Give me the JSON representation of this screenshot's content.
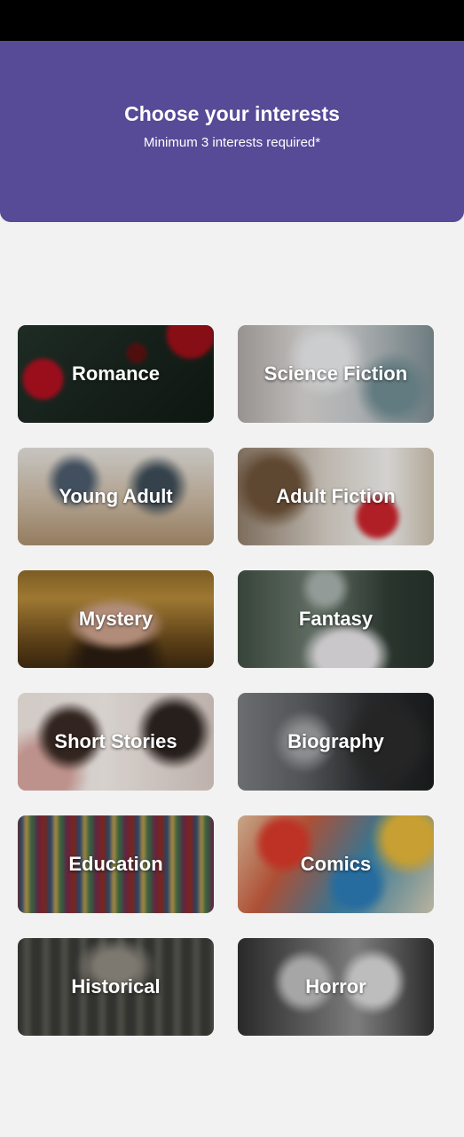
{
  "header": {
    "title": "Choose your interests",
    "subtitle": "Minimum 3 interests required*"
  },
  "interests": [
    {
      "label": "Romance",
      "background": "radial-gradient(circle at 15% 55%, #b01020 0 10%, transparent 12%), radial-gradient(circle at 86% 12%, #9b1018 0 11%, transparent 13%), radial-gradient(circle at 60% 30%, #5b1210 0 6%, transparent 8%), linear-gradient(135deg, #22332a 0%, #1a261f 45%, #101a14 100%)"
    },
    {
      "label": "Science Fiction",
      "background": "radial-gradient(circle at 45% 35%, #e9eaec 0 16%, transparent 30%), radial-gradient(circle at 78% 65%, #6f8c92 0 12%, transparent 22%), linear-gradient(90deg, #a9a3a0 0%, #d9d6d4 35%, #c4c8ca 60%, #77898e 100%)"
    },
    {
      "label": "Young Adult",
      "background": "radial-gradient(circle at 30% 35%, #4a5a6b 0 10%, transparent 18%), radial-gradient(circle at 70% 40%, #3d4c57 0 11%, transparent 20%), linear-gradient(180deg, #e4e2df 0%, #cbbba6 50%, #a88c6a 100%)"
    },
    {
      "label": "Adult Fiction",
      "background": "radial-gradient(circle at 70% 70%, #c9242c 0 11%, transparent 15%), radial-gradient(circle at 20% 40%, #6d5238 0 14%, transparent 24%), linear-gradient(90deg, #8a7764 0%, #d7d0c6 45%, #f0efed 75%, #c7b9a5 100%)"
    },
    {
      "label": "Mystery",
      "background": "radial-gradient(ellipse at 50% 55%, #caa089 0 22%, transparent 34%), radial-gradient(ellipse at 50% 95%, #2b1c10 0 22%, transparent 36%), linear-gradient(180deg, #8a6628 0%, #b58a3a 30%, #6a4a1c 70%, #3a2810 100%)"
    },
    {
      "label": "Fantasy",
      "background": "radial-gradient(ellipse at 55% 85%, #e6e3e6 0 18%, transparent 28%), radial-gradient(circle at 45% 20%, #a7b1ac 0 10%, transparent 18%), linear-gradient(90deg, #3b4a3f 0%, #6f7d72 40%, #2f3d34 75%, #24322a 100%)"
    },
    {
      "label": "Short Stories",
      "background": "radial-gradient(circle at 28% 45%, #3a2a24 0 14%, transparent 22%), radial-gradient(circle at 78% 40%, #2c2420 0 14%, transparent 22%), radial-gradient(circle at 15% 80%, #d8a6a0 0 14%, transparent 24%), linear-gradient(90deg, #efe6e1 0%, #f4eeea 45%, #d7c8c2 100%)"
    },
    {
      "label": "Biography",
      "background": "radial-gradient(circle at 35% 50%, #9fa1a3 0 10%, transparent 22%), radial-gradient(circle at 75% 50%, #2b2b2b 0 16%, transparent 28%), linear-gradient(90deg, #7d7f82 0%, #5c5e61 35%, #2e2f31 65%, #1a1b1c 100%)"
    },
    {
      "label": "Education",
      "background": "repeating-linear-gradient(90deg, #8b2b22 0 7px, #2c4c73 7px 13px, #c9a04a 13px 18px, #3b6b48 18px 25px, #6f2a4e 25px 31px), linear-gradient(180deg, rgba(0,0,0,0.55) 0%, rgba(0,0,0,0.15) 50%, rgba(0,0,0,0.55) 100%)"
    },
    {
      "label": "Comics",
      "background": "radial-gradient(circle at 25% 30%, #d83a2a 0 12%, transparent 18%), radial-gradient(circle at 60% 70%, #2c7bb5 0 14%, transparent 22%), radial-gradient(circle at 85% 25%, #e3b53a 0 12%, transparent 20%), linear-gradient(120deg, #e6c9a6 0%, #c65b3d 30%, #3e86a8 60%, #e0d2b4 100%)"
    },
    {
      "label": "Historical",
      "background": "radial-gradient(ellipse at 50% 30%, #8f8a80 0 14%, transparent 28%), repeating-linear-gradient(90deg, #3a3a36 0 12px, #565650 12px 20px), linear-gradient(180deg, #6b6a64 0%, #2c2c29 100%)"
    },
    {
      "label": "Horror",
      "background": "radial-gradient(circle at 35% 45%, #bdbdbd 0 14%, transparent 22%), radial-gradient(circle at 68% 45%, #d8d8d8 0 14%, transparent 22%), linear-gradient(90deg, #2b2b2b 0%, #6c6c6c 40%, #8f8f8f 60%, #2a2a2a 100%)"
    }
  ]
}
